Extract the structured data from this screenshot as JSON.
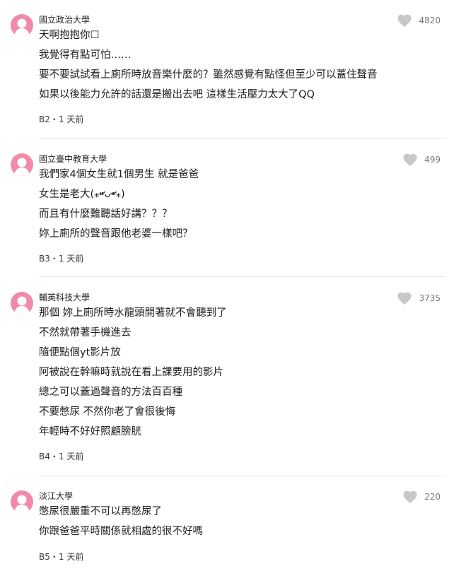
{
  "colors": {
    "avatar": "#f08aa8",
    "heart": "#c8c8c8",
    "divider": "#e6e6e6"
  },
  "comments": [
    {
      "school": "國立政治大學",
      "likes": "4820",
      "lines": [
        "天啊抱抱你☐",
        "我覺得有點可怕……",
        "要不要試試看上廁所時放音樂什麼的？雖然感覺有點怪但至少可以蓋住聲音",
        "如果以後能力允許的話還是搬出去吧  這樣生活壓力太大了QQ"
      ],
      "meta": "B2・1 天前"
    },
    {
      "school": "國立臺中教育大學",
      "likes": "499",
      "lines": [
        "我們家4個女生就1個男生 就是爸爸",
        "女生是老大(⁎⁍̴̛ᴗ⁍̴̛⁎)",
        "而且有什麼難聽話好講？？？",
        "妳上廁所的聲音跟他老婆一樣吧？"
      ],
      "meta": "B3・1 天前"
    },
    {
      "school": "輔英科技大學",
      "likes": "3735",
      "lines": [
        "那個 妳上廁所時水龍頭開著就不會聽到了",
        "不然就帶著手機進去",
        "隨便點個yt影片放",
        "阿被說在幹嘛時就說在看上課要用的影片",
        "總之可以蓋過聲音的方法百百種",
        "不要憋尿 不然你老了會很後悔",
        "年輕時不好好照顧膀胱"
      ],
      "meta": "B4・1 天前"
    },
    {
      "school": "淡江大學",
      "likes": "220",
      "lines": [
        "憋尿很嚴重不可以再憋尿了",
        "你跟爸爸平時關係就相處的很不好嗎"
      ],
      "meta": "B5・1 天前"
    }
  ]
}
